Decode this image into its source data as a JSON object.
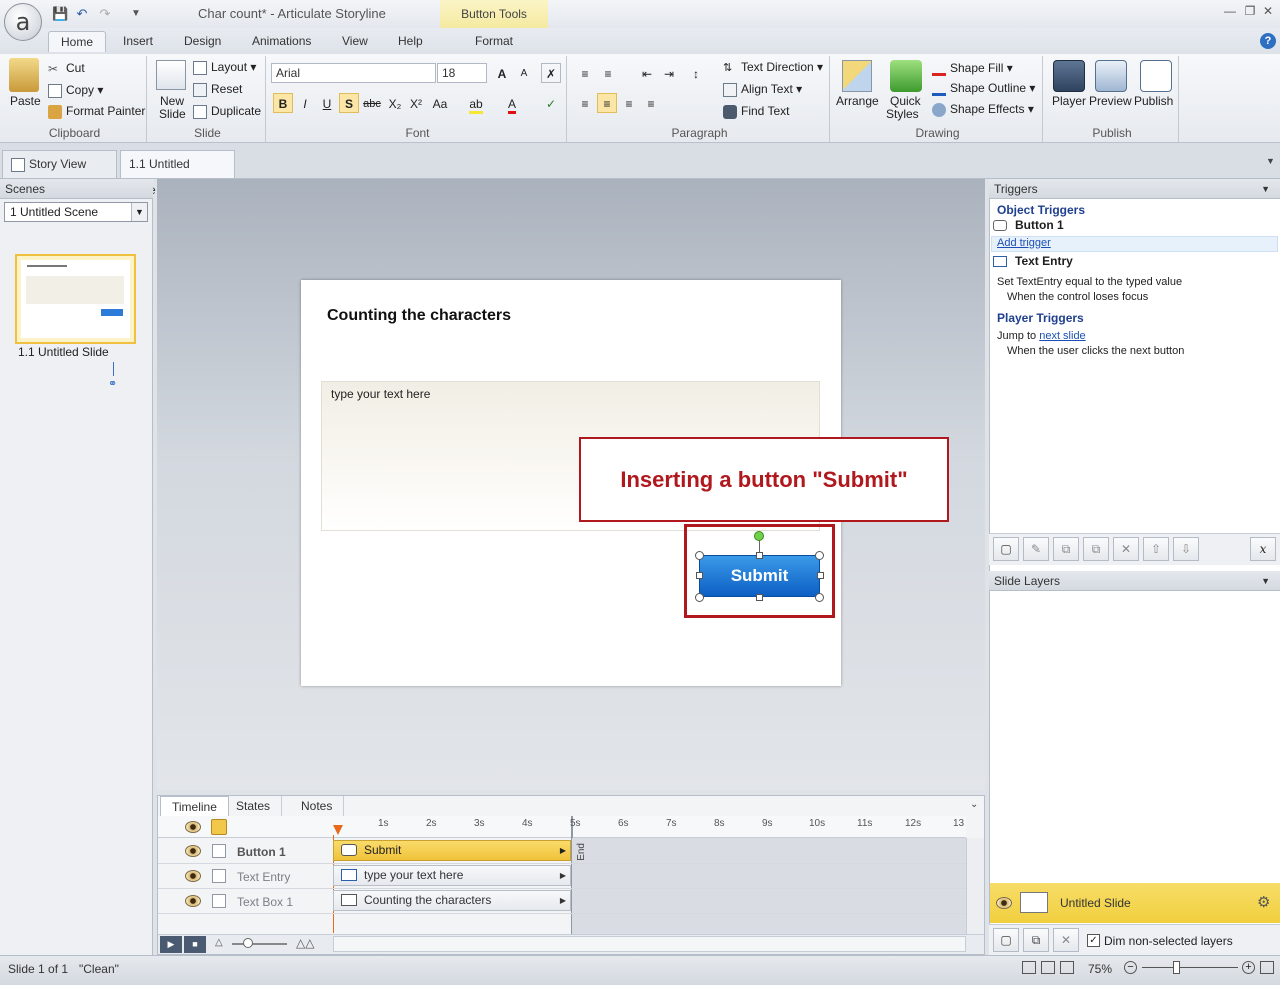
{
  "window": {
    "title": "Char count* -  Articulate Storyline",
    "contextual_tab": "Button Tools"
  },
  "ribbon_tabs": [
    "Home",
    "Insert",
    "Design",
    "Animations",
    "View",
    "Help",
    "Format"
  ],
  "ribbon": {
    "clipboard": {
      "paste": "Paste",
      "cut": "Cut",
      "copy": "Copy",
      "format_painter": "Format Painter",
      "label": "Clipboard"
    },
    "slide": {
      "new_slide_1": "New",
      "new_slide_2": "Slide",
      "layout": "Layout",
      "reset": "Reset",
      "duplicate": "Duplicate",
      "label": "Slide"
    },
    "font": {
      "family": "Arial",
      "size": "18",
      "label": "Font",
      "grow": "A",
      "shrink": "A",
      "bold": "B",
      "italic": "I",
      "underline": "U",
      "shadow": "S",
      "strike": "abc",
      "sub": "X₂",
      "sup": "X²",
      "case": "Aa"
    },
    "paragraph": {
      "text_direction": "Text Direction",
      "align_text": "Align Text",
      "find_text": "Find Text",
      "label": "Paragraph"
    },
    "drawing": {
      "arrange": "Arrange",
      "quick_styles_1": "Quick",
      "quick_styles_2": "Styles",
      "shape_fill": "Shape Fill",
      "shape_outline": "Shape Outline",
      "shape_effects": "Shape Effects",
      "label": "Drawing"
    },
    "publish": {
      "player": "Player",
      "preview": "Preview",
      "publish": "Publish",
      "label": "Publish"
    }
  },
  "doc_tabs": {
    "story_view": "Story View",
    "slide_tab": "1.1 Untitled Slide"
  },
  "scenes": {
    "header": "Scenes",
    "selected": "1 Untitled Scene",
    "thumb_label": "1.1 Untitled Slide"
  },
  "slide": {
    "title": "Counting the characters",
    "text_entry": "type your text here",
    "callout": "Inserting a button \"Submit\"",
    "button": "Submit"
  },
  "timeline": {
    "tabs": [
      "Timeline",
      "States",
      "Notes"
    ],
    "ruler": [
      "1s",
      "2s",
      "3s",
      "4s",
      "5s",
      "6s",
      "7s",
      "8s",
      "9s",
      "10s",
      "11s",
      "12s",
      "13"
    ],
    "end_label": "End",
    "rows": [
      {
        "name": "Button 1",
        "bar": "Submit"
      },
      {
        "name": "Text Entry",
        "bar": "type your text here"
      },
      {
        "name": "Text Box 1",
        "bar": "Counting the characters"
      }
    ]
  },
  "triggers": {
    "header": "Triggers",
    "object_triggers": "Object Triggers",
    "button1": "Button 1",
    "add_trigger": "Add trigger",
    "text_entry": "Text Entry",
    "te_action": "Set TextEntry equal to the typed value",
    "te_when": "When the control loses focus",
    "player_triggers": "Player Triggers",
    "jump_prefix": "Jump to",
    "jump_link": "next slide",
    "jump_when": "When the user clicks the next button"
  },
  "layers": {
    "header": "Slide Layers",
    "base": "Untitled Slide",
    "dim_label": "Dim non-selected layers",
    "dim_checked": true
  },
  "status": {
    "slide": "Slide 1 of 1",
    "theme": "\"Clean\"",
    "zoom": "75%"
  },
  "colors": {
    "accent_red": "#b0181d",
    "button_blue": "#0c5fc4",
    "selection_yellow": "#f0c23a"
  }
}
